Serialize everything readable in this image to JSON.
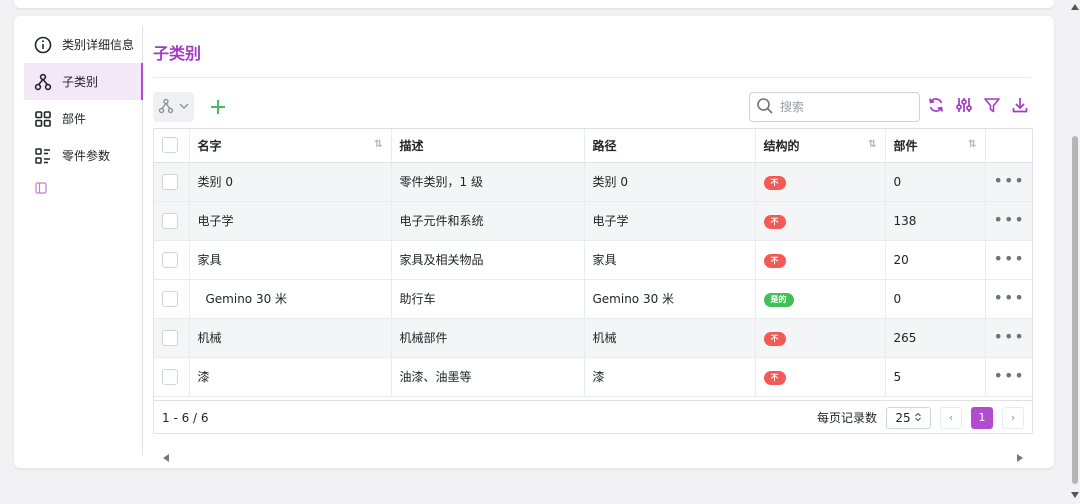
{
  "sidebar": {
    "items": [
      {
        "label": "类别详细信息",
        "icon": "info-icon",
        "active": false
      },
      {
        "label": "子类别",
        "icon": "hierarchy-icon",
        "active": true
      },
      {
        "label": "部件",
        "icon": "grid-icon",
        "active": false
      },
      {
        "label": "零件参数",
        "icon": "list-details-icon",
        "active": false
      }
    ]
  },
  "page": {
    "title": "子类别"
  },
  "search": {
    "placeholder": "搜索"
  },
  "table": {
    "columns": [
      "名字",
      "描述",
      "路径",
      "结构的",
      "部件"
    ],
    "rows": [
      {
        "name": "类别 0",
        "description": "零件类别，1 级",
        "path": "类别 0",
        "structural": "不",
        "parts": "0"
      },
      {
        "name": "电子学",
        "description": "电子元件和系统",
        "path": "电子学",
        "structural": "不",
        "parts": "138"
      },
      {
        "name": "家具",
        "description": "家具及相关物品",
        "path": "家具",
        "structural": "不",
        "parts": "20"
      },
      {
        "name": "Gemino 30 米",
        "description": "助行车",
        "path": "Gemino 30 米",
        "structural": "是的",
        "parts": "0"
      },
      {
        "name": "机械",
        "description": "机械部件",
        "path": "机械",
        "structural": "不",
        "parts": "265"
      },
      {
        "name": "漆",
        "description": "油漆、油墨等",
        "path": "漆",
        "structural": "不",
        "parts": "5"
      }
    ],
    "row_action": "•••"
  },
  "pagination": {
    "range": "1 - 6 / 6",
    "per_page_label": "每页记录数",
    "per_page": "25",
    "prev": "‹",
    "current_page": "1",
    "next": "›"
  },
  "colors": {
    "accent": "#a53ac5",
    "no_badge": "#f15a55",
    "yes_badge": "#40c057",
    "add": "#40c057"
  }
}
